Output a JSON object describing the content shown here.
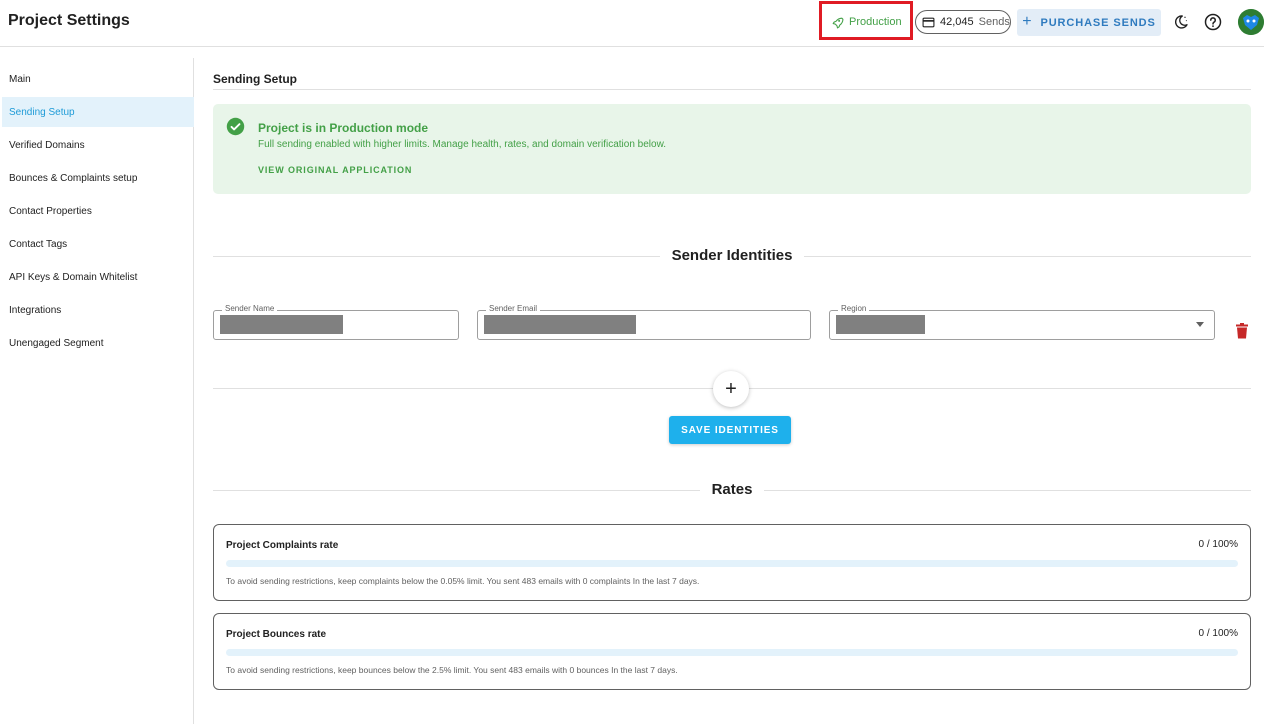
{
  "header": {
    "title": "Project Settings",
    "production_label": "Production",
    "sends_count": "42,045",
    "sends_label": "Sends",
    "purchase_label": "PURCHASE SENDS",
    "icons": [
      "rocket-icon",
      "credit-card-icon",
      "moon-icon",
      "help-icon",
      "avatar"
    ]
  },
  "sidebar": {
    "items": [
      {
        "label": "Main",
        "active": false
      },
      {
        "label": "Sending Setup",
        "active": true
      },
      {
        "label": "Verified Domains",
        "active": false
      },
      {
        "label": "Bounces & Complaints setup",
        "active": false
      },
      {
        "label": "Contact Properties",
        "active": false
      },
      {
        "label": "Contact Tags",
        "active": false
      },
      {
        "label": "API Keys & Domain Whitelist",
        "active": false
      },
      {
        "label": "Integrations",
        "active": false
      },
      {
        "label": "Unengaged Segment",
        "active": false
      }
    ]
  },
  "main": {
    "section_title": "Sending Setup",
    "alert": {
      "title": "Project is in Production mode",
      "text": "Full sending enabled with higher limits. Manage health, rates, and domain verification below.",
      "link": "VIEW ORIGINAL APPLICATION"
    },
    "identities": {
      "heading": "Sender Identities",
      "sender_name_label": "Sender Name",
      "sender_email_label": "Sender Email",
      "region_label": "Region",
      "save_label": "SAVE IDENTITIES"
    },
    "rates": {
      "heading": "Rates",
      "cards": [
        {
          "title": "Project Complaints rate",
          "value": "0 / 100%",
          "progress": 0,
          "note": "To avoid sending restrictions, keep complaints below the 0.05% limit. You sent 483 emails with 0 complaints In the last 7 days."
        },
        {
          "title": "Project Bounces rate",
          "value": "0 / 100%",
          "progress": 0,
          "note": "To avoid sending restrictions, keep bounces below the 2.5% limit. You sent 483 emails with 0 bounces In the last 7 days."
        }
      ]
    }
  },
  "colors": {
    "accent": "#1eb0ec",
    "success": "#43a047",
    "highlight": "#e01b24",
    "danger": "#c62828"
  }
}
